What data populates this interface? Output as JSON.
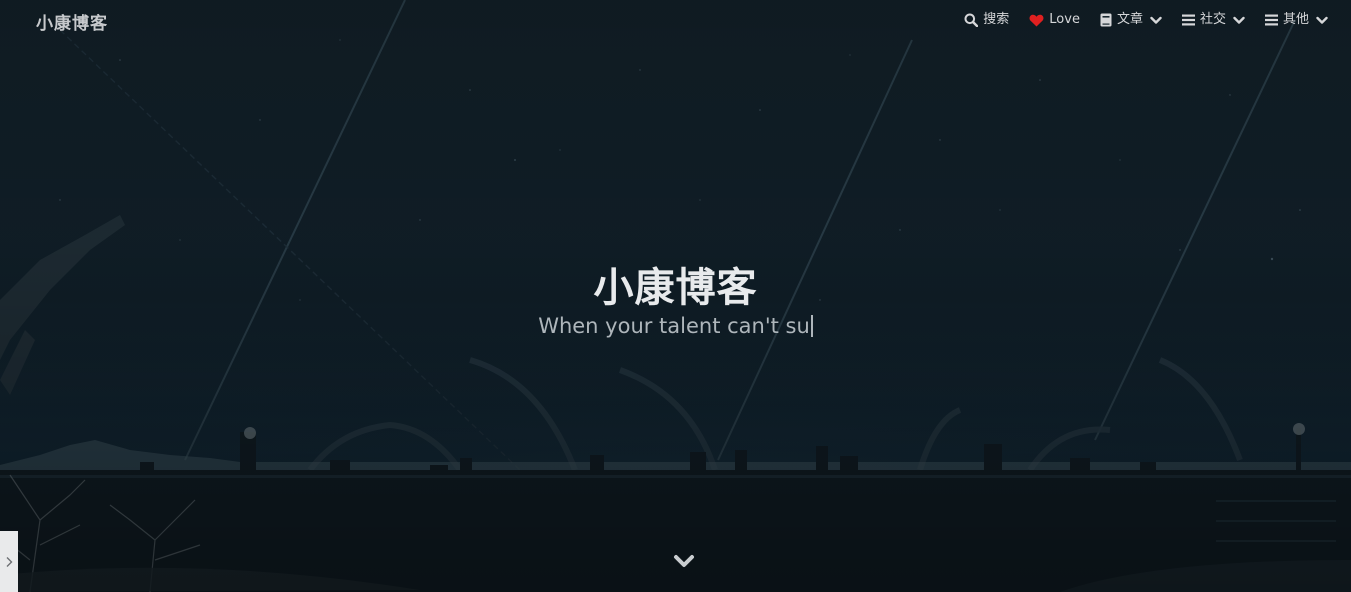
{
  "header": {
    "brand": "小康博客",
    "nav": [
      {
        "label": "搜索",
        "icon": "search-icon"
      },
      {
        "label": "Love",
        "icon": "heart-icon"
      },
      {
        "label": "文章",
        "icon": "book-icon",
        "dropdown": true
      },
      {
        "label": "社交",
        "icon": "list-icon",
        "dropdown": true
      },
      {
        "label": "其他",
        "icon": "list-icon",
        "dropdown": true
      }
    ]
  },
  "hero": {
    "title": "小康博客",
    "subtitle": "When your talent can't su"
  },
  "colors": {
    "heart": "#e02020",
    "nav_text": "#d6d7d9",
    "title_text": "#e8eaec",
    "subtitle_text": "#aeb6bb",
    "sky": "#0f1c24"
  },
  "icons": {
    "scroll": "chevron-down-icon",
    "side_tab": "chevron-right-icon"
  }
}
